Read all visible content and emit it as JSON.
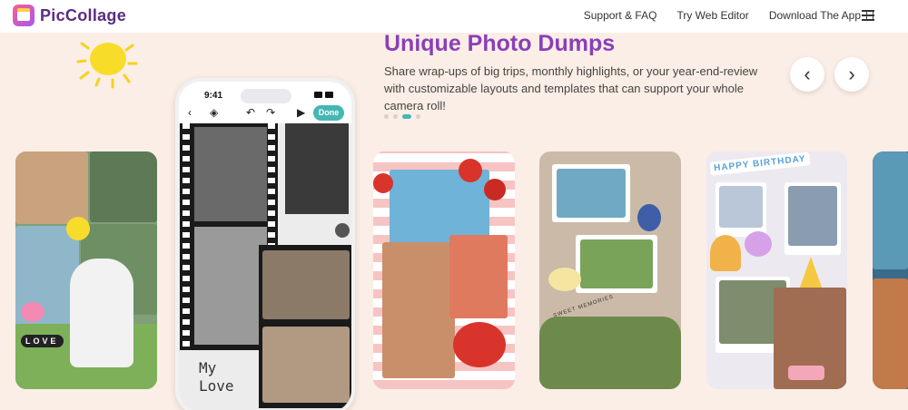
{
  "header": {
    "brand": "PicCollage",
    "nav": [
      {
        "label": "Support & FAQ"
      },
      {
        "label": "Try Web Editor"
      },
      {
        "label": "Download The App"
      }
    ]
  },
  "hero": {
    "title": "Unique Photo Dumps",
    "description": "Share wrap-ups of big trips, monthly highlights, or your year-end-review with customizable layouts and templates that can support your whole camera roll!",
    "prev_icon": "chevron-left-icon",
    "next_icon": "chevron-right-icon",
    "slide_count": 4,
    "active_slide": 3
  },
  "phone": {
    "time": "9:41",
    "done_label": "Done",
    "sticker_text_line1": "My",
    "sticker_text_line2": "Love"
  },
  "cards": {
    "card1_sticker": "LOVE",
    "card4_caption": "SWEET MEMORIES",
    "card5_banner": "HAPPY BIRTHDAY"
  },
  "colors": {
    "background": "#fbeee6",
    "brand_purple": "#8a3fb8",
    "accent_teal": "#45b7b3"
  }
}
